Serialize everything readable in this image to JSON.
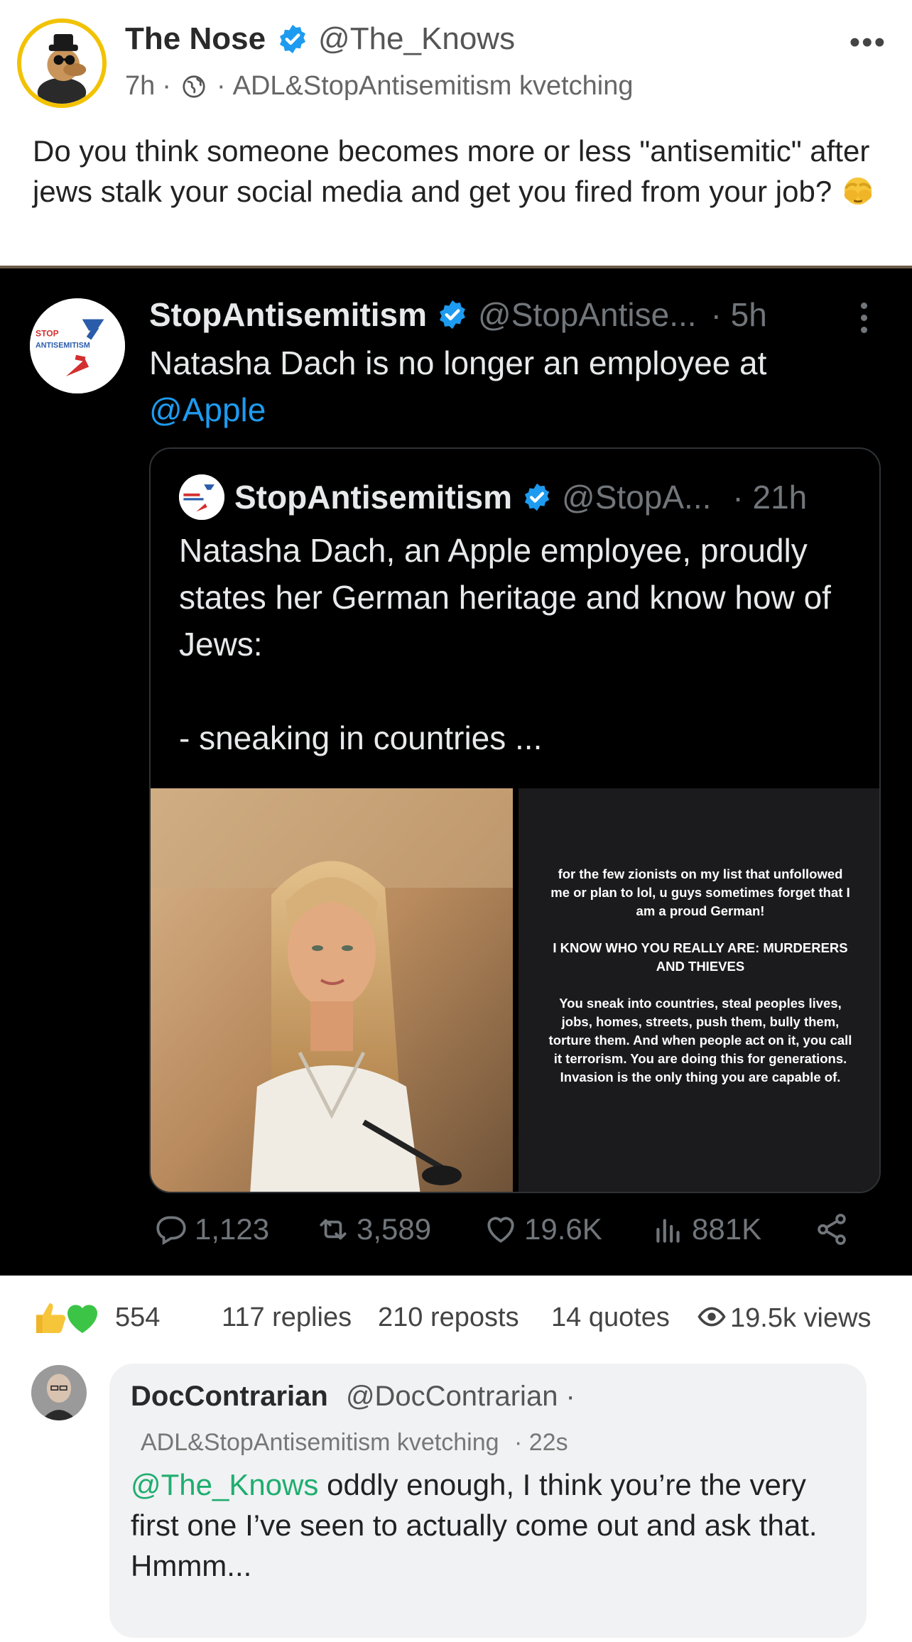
{
  "post": {
    "author_name": "The Nose",
    "author_handle": "@The_Knows",
    "time": "7h",
    "dot": "·",
    "group": "ADL&StopAntisemitism kvetching",
    "more": "•••",
    "text": "Do you think someone becomes more or less \"antisemitic\" after jews stalk your social media and get you fired from your job?",
    "emoji": "face-in-hands-emoji"
  },
  "embed": {
    "author_name": "StopAntisemitism",
    "author_handle": "@StopAntise...",
    "time": "· 5h",
    "text": "Natasha Dach is no longer an employee at ",
    "mention": "@Apple",
    "quote": {
      "author_name": "StopAntisemitism",
      "author_handle": "@StopA...",
      "time": "· 21h",
      "text": "Natasha Dach, an Apple employee, proudly states her German heritage and know how of Jews:\n\n- sneaking in countries ...",
      "story": {
        "p1": "for the few zionists on my list that unfollowed me or plan to lol, u guys sometimes forget that I am a proud German!",
        "p2": "I KNOW WHO YOU REALLY ARE: MURDERERS AND THIEVES",
        "p3": "You sneak into countries, steal peoples lives, jobs, homes, streets, push them, bully them, torture them. And when people act on it, you call it terrorism. You are doing this for generations. Invasion is the only thing you are capable of."
      }
    },
    "actions": {
      "replies": "1,123",
      "reposts": "3,589",
      "likes": "19.6K",
      "views": "881K"
    },
    "logo_text": {
      "stop": "STOP",
      "antisemitism": "ANTISEMITISM"
    }
  },
  "stats": {
    "reaction_count": "554",
    "replies": "117 replies",
    "reposts": "210 reposts",
    "quotes": "14 quotes",
    "views": "19.5k views"
  },
  "comment": {
    "author_name": "DocContrarian",
    "author_handle": "@DocContrarian ·",
    "group": "ADL&StopAntisemitism kvetching",
    "time": "· 22s",
    "mention": "@The_Knows",
    "text": " oddly enough, I think you’re the very first one I’ve seen to actually come out and ask that.\nHmmm..."
  },
  "colors": {
    "verified_blue": "#1d9bf0",
    "mention_green": "#1fae6f",
    "avatar_ring": "#f2c200",
    "embed_bg": "#000000",
    "comment_bg": "#f1f2f4"
  }
}
